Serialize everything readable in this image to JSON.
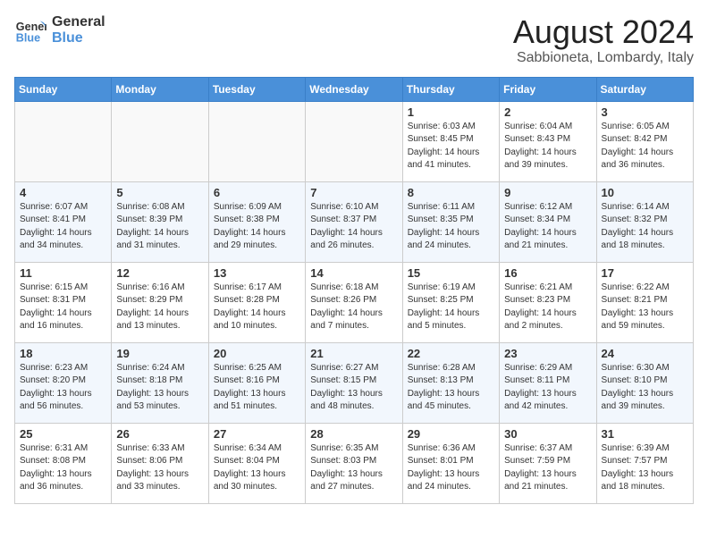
{
  "header": {
    "logo_line1": "General",
    "logo_line2": "Blue",
    "title": "August 2024",
    "subtitle": "Sabbioneta, Lombardy, Italy"
  },
  "weekdays": [
    "Sunday",
    "Monday",
    "Tuesday",
    "Wednesday",
    "Thursday",
    "Friday",
    "Saturday"
  ],
  "weeks": [
    [
      {
        "day": "",
        "info": ""
      },
      {
        "day": "",
        "info": ""
      },
      {
        "day": "",
        "info": ""
      },
      {
        "day": "",
        "info": ""
      },
      {
        "day": "1",
        "info": "Sunrise: 6:03 AM\nSunset: 8:45 PM\nDaylight: 14 hours\nand 41 minutes."
      },
      {
        "day": "2",
        "info": "Sunrise: 6:04 AM\nSunset: 8:43 PM\nDaylight: 14 hours\nand 39 minutes."
      },
      {
        "day": "3",
        "info": "Sunrise: 6:05 AM\nSunset: 8:42 PM\nDaylight: 14 hours\nand 36 minutes."
      }
    ],
    [
      {
        "day": "4",
        "info": "Sunrise: 6:07 AM\nSunset: 8:41 PM\nDaylight: 14 hours\nand 34 minutes."
      },
      {
        "day": "5",
        "info": "Sunrise: 6:08 AM\nSunset: 8:39 PM\nDaylight: 14 hours\nand 31 minutes."
      },
      {
        "day": "6",
        "info": "Sunrise: 6:09 AM\nSunset: 8:38 PM\nDaylight: 14 hours\nand 29 minutes."
      },
      {
        "day": "7",
        "info": "Sunrise: 6:10 AM\nSunset: 8:37 PM\nDaylight: 14 hours\nand 26 minutes."
      },
      {
        "day": "8",
        "info": "Sunrise: 6:11 AM\nSunset: 8:35 PM\nDaylight: 14 hours\nand 24 minutes."
      },
      {
        "day": "9",
        "info": "Sunrise: 6:12 AM\nSunset: 8:34 PM\nDaylight: 14 hours\nand 21 minutes."
      },
      {
        "day": "10",
        "info": "Sunrise: 6:14 AM\nSunset: 8:32 PM\nDaylight: 14 hours\nand 18 minutes."
      }
    ],
    [
      {
        "day": "11",
        "info": "Sunrise: 6:15 AM\nSunset: 8:31 PM\nDaylight: 14 hours\nand 16 minutes."
      },
      {
        "day": "12",
        "info": "Sunrise: 6:16 AM\nSunset: 8:29 PM\nDaylight: 14 hours\nand 13 minutes."
      },
      {
        "day": "13",
        "info": "Sunrise: 6:17 AM\nSunset: 8:28 PM\nDaylight: 14 hours\nand 10 minutes."
      },
      {
        "day": "14",
        "info": "Sunrise: 6:18 AM\nSunset: 8:26 PM\nDaylight: 14 hours\nand 7 minutes."
      },
      {
        "day": "15",
        "info": "Sunrise: 6:19 AM\nSunset: 8:25 PM\nDaylight: 14 hours\nand 5 minutes."
      },
      {
        "day": "16",
        "info": "Sunrise: 6:21 AM\nSunset: 8:23 PM\nDaylight: 14 hours\nand 2 minutes."
      },
      {
        "day": "17",
        "info": "Sunrise: 6:22 AM\nSunset: 8:21 PM\nDaylight: 13 hours\nand 59 minutes."
      }
    ],
    [
      {
        "day": "18",
        "info": "Sunrise: 6:23 AM\nSunset: 8:20 PM\nDaylight: 13 hours\nand 56 minutes."
      },
      {
        "day": "19",
        "info": "Sunrise: 6:24 AM\nSunset: 8:18 PM\nDaylight: 13 hours\nand 53 minutes."
      },
      {
        "day": "20",
        "info": "Sunrise: 6:25 AM\nSunset: 8:16 PM\nDaylight: 13 hours\nand 51 minutes."
      },
      {
        "day": "21",
        "info": "Sunrise: 6:27 AM\nSunset: 8:15 PM\nDaylight: 13 hours\nand 48 minutes."
      },
      {
        "day": "22",
        "info": "Sunrise: 6:28 AM\nSunset: 8:13 PM\nDaylight: 13 hours\nand 45 minutes."
      },
      {
        "day": "23",
        "info": "Sunrise: 6:29 AM\nSunset: 8:11 PM\nDaylight: 13 hours\nand 42 minutes."
      },
      {
        "day": "24",
        "info": "Sunrise: 6:30 AM\nSunset: 8:10 PM\nDaylight: 13 hours\nand 39 minutes."
      }
    ],
    [
      {
        "day": "25",
        "info": "Sunrise: 6:31 AM\nSunset: 8:08 PM\nDaylight: 13 hours\nand 36 minutes."
      },
      {
        "day": "26",
        "info": "Sunrise: 6:33 AM\nSunset: 8:06 PM\nDaylight: 13 hours\nand 33 minutes."
      },
      {
        "day": "27",
        "info": "Sunrise: 6:34 AM\nSunset: 8:04 PM\nDaylight: 13 hours\nand 30 minutes."
      },
      {
        "day": "28",
        "info": "Sunrise: 6:35 AM\nSunset: 8:03 PM\nDaylight: 13 hours\nand 27 minutes."
      },
      {
        "day": "29",
        "info": "Sunrise: 6:36 AM\nSunset: 8:01 PM\nDaylight: 13 hours\nand 24 minutes."
      },
      {
        "day": "30",
        "info": "Sunrise: 6:37 AM\nSunset: 7:59 PM\nDaylight: 13 hours\nand 21 minutes."
      },
      {
        "day": "31",
        "info": "Sunrise: 6:39 AM\nSunset: 7:57 PM\nDaylight: 13 hours\nand 18 minutes."
      }
    ]
  ]
}
